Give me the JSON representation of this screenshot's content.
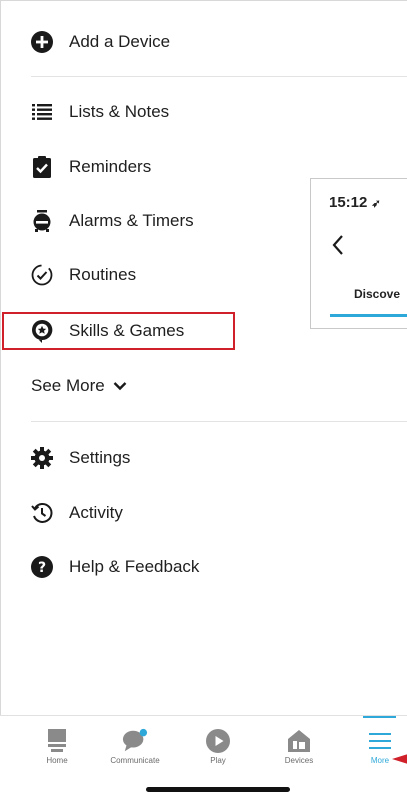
{
  "menu": {
    "add_device": "Add a Device",
    "lists_notes": "Lists & Notes",
    "reminders": "Reminders",
    "alarms_timers": "Alarms & Timers",
    "routines": "Routines",
    "skills_games": "Skills & Games",
    "see_more": "See More",
    "settings": "Settings",
    "activity": "Activity",
    "help_feedback": "Help & Feedback"
  },
  "inset": {
    "time": "15:12",
    "tab_label": "Discove"
  },
  "bottom_nav": {
    "home": "Home",
    "communicate": "Communicate",
    "play": "Play",
    "devices": "Devices",
    "more": "More"
  },
  "colors": {
    "accent": "#2ea8d8",
    "highlight": "#d0202a",
    "icon": "#1a1a1a"
  }
}
